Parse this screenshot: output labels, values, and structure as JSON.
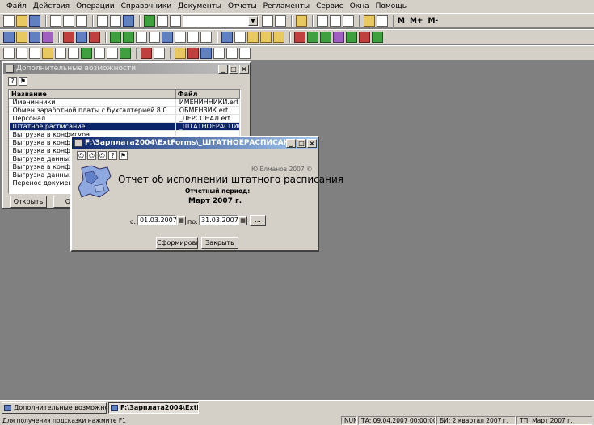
{
  "menu": [
    "Файл",
    "Действия",
    "Операции",
    "Справочники",
    "Документы",
    "Отчеты",
    "Регламенты",
    "Сервис",
    "Окна",
    "Помощь"
  ],
  "toolbar_m_buttons": [
    "M",
    "M+",
    "M-"
  ],
  "windows": {
    "additional": {
      "title": "Дополнительные возможности",
      "columns": [
        "Название",
        "Файл"
      ],
      "rows": [
        {
          "name": "Именинники",
          "file": "ИМЕНИННИКИ.ert"
        },
        {
          "name": "Обмен заработной платы с бухгалтерией 8.0",
          "file": "ОБМЕН3ИК.ert"
        },
        {
          "name": "Персонал",
          "file": "_ПЕРСОНАЛ.ert"
        },
        {
          "name": "Штатное расписание",
          "file": "_ШТАТНОЕРАСПИС"
        },
        {
          "name": "Выгрузка в конфигура",
          "file": ""
        },
        {
          "name": "Выгрузка в конфигура",
          "file": ""
        },
        {
          "name": "Выгрузка в конфигура",
          "file": ""
        },
        {
          "name": "Выгрузка данных в ко",
          "file": ""
        },
        {
          "name": "Выгрузка в конфигура",
          "file": ""
        },
        {
          "name": "Выгрузка данных в ко",
          "file": ""
        },
        {
          "name": "Перенос документов и",
          "file": ""
        }
      ],
      "open_button": "Открыть",
      "second_button": "Обн"
    },
    "report": {
      "title": "F:\\Зарплата2004\\ExtForms\\_ШТАТНОЕРАСПИСАНИЕ.ert",
      "copyright": "Ю.Елманов 2007 ©",
      "heading": "Отчет об исполнении штатного расписания",
      "period_label": "Отчетный период:",
      "period_value": "Март 2007 г.",
      "from_label": "с:",
      "from_value": "01.03.2007",
      "to_label": "по:",
      "to_value": "31.03.2007",
      "ellipsis_button": "...",
      "build_button": "Сформировать",
      "close_button": "Закрыть"
    }
  },
  "taskbar": [
    "Дополнительные возможности",
    "F:\\Зарплата2004\\ExtForms..."
  ],
  "status": {
    "hint": "Для получения подсказки нажмите F1",
    "num": "NUM",
    "ta": "ТА: 09.04.2007  00:00:00",
    "bi": "БИ: 2 квартал 2007 г.",
    "tp": "ТП: Март 2007 г."
  }
}
